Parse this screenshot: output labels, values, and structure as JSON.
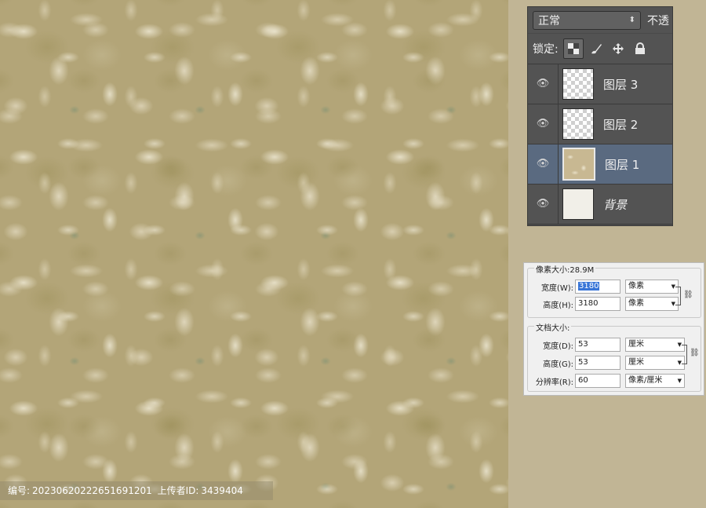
{
  "watermark": {
    "id_label": "编号:",
    "id_value": "20230620222651691201",
    "uploader_label": "上传者ID:",
    "uploader_value": "3439404"
  },
  "layers_panel": {
    "blend_mode": "正常",
    "opacity_label": "不透",
    "lock_label": "锁定:",
    "lock_icons": [
      "lock-transparent-icon",
      "brush-icon",
      "move-icon",
      "padlock-icon"
    ],
    "layers": [
      {
        "name": "图层 3",
        "visible": true,
        "selected": false,
        "thumb": "transparent"
      },
      {
        "name": "图层 2",
        "visible": true,
        "selected": false,
        "thumb": "transparent"
      },
      {
        "name": "图层 1",
        "visible": true,
        "selected": true,
        "thumb": "texture"
      },
      {
        "name": "背景",
        "visible": true,
        "selected": false,
        "thumb": "white"
      }
    ]
  },
  "image_size": {
    "pixel_group_title": "像素大小:28.9M",
    "width_label": "宽度(W):",
    "width_value": "3180",
    "width_unit": "像素",
    "height_label": "高度(H):",
    "height_value": "3180",
    "height_unit": "像素",
    "doc_group_title": "文档大小:",
    "doc_width_label": "宽度(D):",
    "doc_width_value": "53",
    "doc_width_unit": "厘米",
    "doc_height_label": "高度(G):",
    "doc_height_value": "53",
    "doc_height_unit": "厘米",
    "resolution_label": "分辨率(R):",
    "resolution_value": "60",
    "resolution_unit": "像素/厘米"
  }
}
